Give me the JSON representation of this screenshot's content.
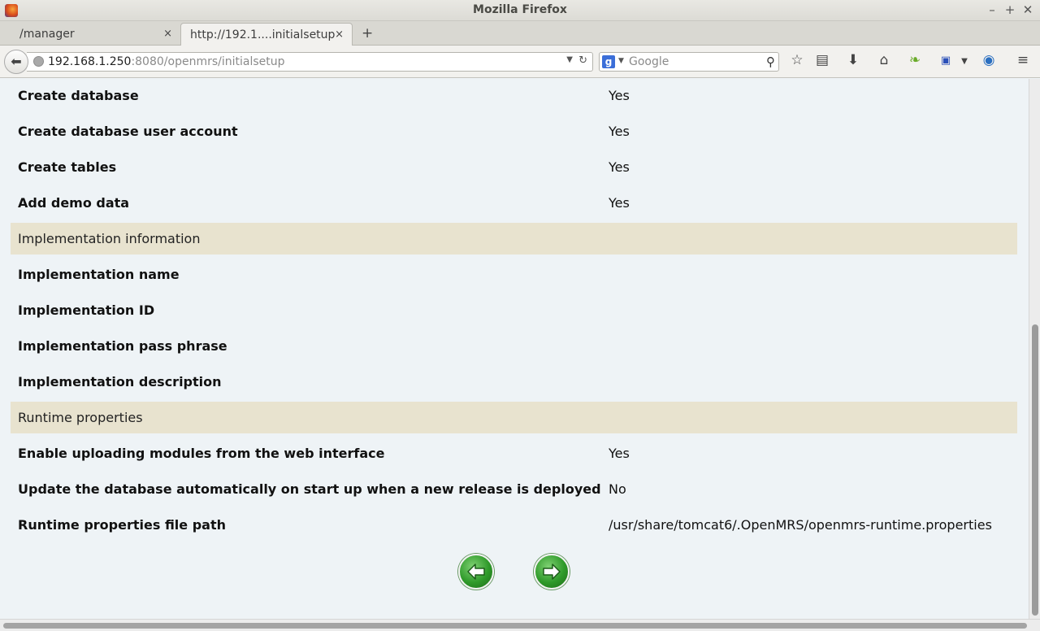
{
  "window": {
    "title": "Mozilla Firefox"
  },
  "tabs": [
    {
      "label": "/manager"
    },
    {
      "label": "http://192.1....initialsetup"
    }
  ],
  "tab_close_glyph": "×",
  "new_tab_glyph": "+",
  "address": {
    "host": "192.168.1.250",
    "rest": ":8080/openmrs/initialsetup"
  },
  "search": {
    "engine": "g",
    "placeholder": "Google"
  },
  "rows_top": [
    {
      "label": "Create database",
      "value": "Yes"
    },
    {
      "label": "Create database user account",
      "value": "Yes"
    },
    {
      "label": "Create tables",
      "value": "Yes"
    },
    {
      "label": "Add demo data",
      "value": "Yes"
    }
  ],
  "section_impl": {
    "title": "Implementation information"
  },
  "rows_impl": [
    {
      "label": "Implementation name",
      "value": ""
    },
    {
      "label": "Implementation ID",
      "value": ""
    },
    {
      "label": "Implementation pass phrase",
      "value": ""
    },
    {
      "label": "Implementation description",
      "value": ""
    }
  ],
  "section_runtime": {
    "title": "Runtime properties"
  },
  "rows_runtime": [
    {
      "label": "Enable uploading modules from the web interface",
      "value": "Yes"
    },
    {
      "label": "Update the database automatically on start up when a new release is deployed",
      "value": "No"
    },
    {
      "label": "Runtime properties file path",
      "value": "/usr/share/tomcat6/.OpenMRS/openmrs-runtime.properties"
    }
  ]
}
